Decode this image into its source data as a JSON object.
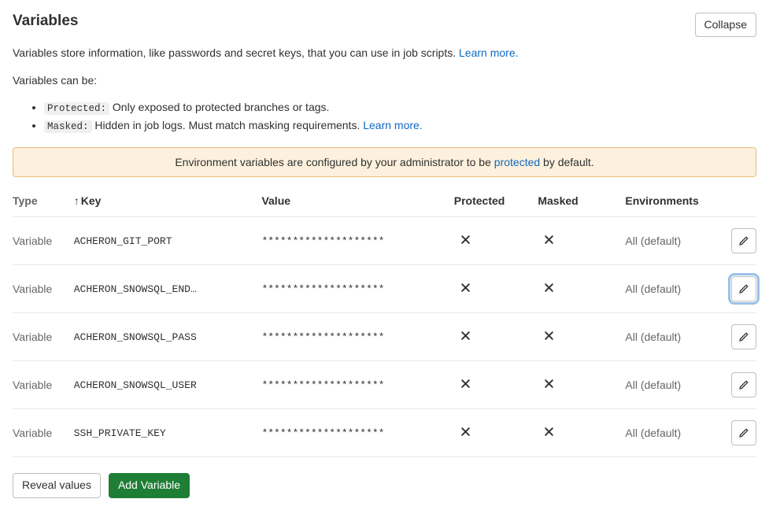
{
  "header": {
    "title": "Variables",
    "collapse_btn": "Collapse"
  },
  "intro": {
    "desc_prefix": "Variables store information, like passwords and secret keys, that you can use in job scripts. ",
    "learn_more": "Learn more.",
    "can_be": "Variables can be:",
    "protected_label": "Protected:",
    "protected_text": " Only exposed to protected branches or tags.",
    "masked_label": "Masked:",
    "masked_text": " Hidden in job logs. Must match masking requirements. ",
    "masked_learn_more": "Learn more."
  },
  "banner": {
    "prefix": "Environment variables are configured by your administrator to be ",
    "link": "protected",
    "suffix": " by default."
  },
  "columns": {
    "type": "Type",
    "key": "Key",
    "value": "Value",
    "protected": "Protected",
    "masked": "Masked",
    "environments": "Environments"
  },
  "sort_arrow": "↑",
  "rows": [
    {
      "type": "Variable",
      "key": "ACHERON_GIT_PORT",
      "value": "********************",
      "protected": false,
      "masked": false,
      "env": "All (default)",
      "focused": false
    },
    {
      "type": "Variable",
      "key": "ACHERON_SNOWSQL_END…",
      "value": "********************",
      "protected": false,
      "masked": false,
      "env": "All (default)",
      "focused": true
    },
    {
      "type": "Variable",
      "key": "ACHERON_SNOWSQL_PASS",
      "value": "********************",
      "protected": false,
      "masked": false,
      "env": "All (default)",
      "focused": false
    },
    {
      "type": "Variable",
      "key": "ACHERON_SNOWSQL_USER",
      "value": "********************",
      "protected": false,
      "masked": false,
      "env": "All (default)",
      "focused": false
    },
    {
      "type": "Variable",
      "key": "SSH_PRIVATE_KEY",
      "value": "********************",
      "protected": false,
      "masked": false,
      "env": "All (default)",
      "focused": false
    }
  ],
  "footer": {
    "reveal": "Reveal values",
    "add": "Add Variable"
  }
}
